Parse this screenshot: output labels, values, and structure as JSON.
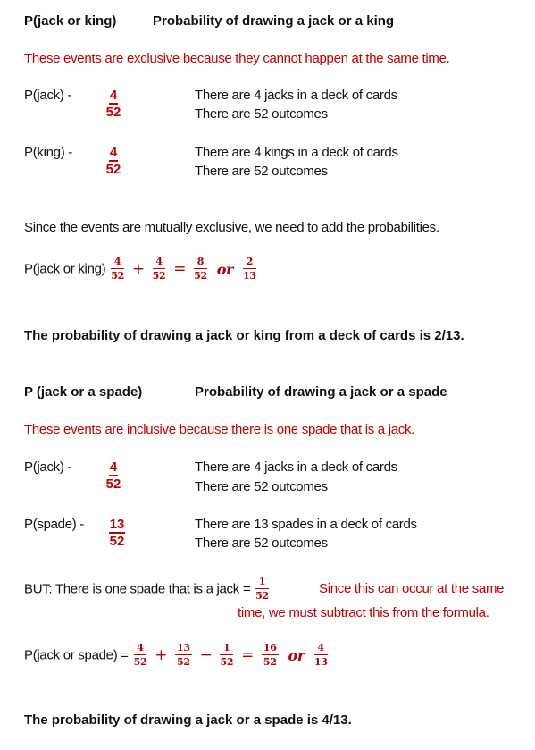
{
  "section1": {
    "label": "P(jack or king)",
    "title": "Probability of drawing a jack or a king",
    "note": "These events are exclusive because they cannot happen at the same time.",
    "rows": [
      {
        "label": "P(jack) -",
        "num": "4",
        "den": "52",
        "line1": "There are 4 jacks in a deck of cards",
        "line2": "There are 52 outcomes"
      },
      {
        "label": "P(king) -",
        "num": "4",
        "den": "52",
        "line1": "There are 4 kings in a deck of cards",
        "line2": "There are 52 outcomes"
      }
    ],
    "explanation": "Since the events are mutually exclusive, we need to add the probabilities.",
    "formula": {
      "label": "P(jack or king)",
      "terms": [
        {
          "num": "4",
          "den": "52"
        },
        {
          "op": "+"
        },
        {
          "num": "4",
          "den": "52"
        },
        {
          "op": "="
        },
        {
          "num": "8",
          "den": "52"
        },
        {
          "word": "or"
        },
        {
          "num": "2",
          "den": "13"
        }
      ]
    },
    "conclusion": "The probability of drawing a jack or king from a deck of cards is 2/13."
  },
  "section2": {
    "label": "P (jack or a spade)",
    "title": "Probability of drawing a jack or a spade",
    "note": "These events are inclusive because there is one spade that is a jack.",
    "rows": [
      {
        "label": "P(jack) -",
        "num": "4",
        "den": "52",
        "line1": "There are 4 jacks in a deck of cards",
        "line2": "There are 52 outcomes"
      },
      {
        "label": "P(spade) -",
        "num": "13",
        "den": "52",
        "line1": "There are 13 spades in a deck of cards",
        "line2": "There are 52 outcomes"
      }
    ],
    "but": {
      "text": "BUT:  There is one spade that is a jack =",
      "num": "1",
      "den": "52",
      "note_line1": "Since this can occur at the same",
      "note_line2": "time, we must subtract this from the formula."
    },
    "formula": {
      "label": "P(jack or spade) =",
      "terms": [
        {
          "num": "4",
          "den": "52"
        },
        {
          "op": "+"
        },
        {
          "num": "13",
          "den": "52"
        },
        {
          "op": "−"
        },
        {
          "num": "1",
          "den": "52"
        },
        {
          "op": "="
        },
        {
          "num": "16",
          "den": "52"
        },
        {
          "word": "or"
        },
        {
          "num": "4",
          "den": "13"
        }
      ]
    },
    "conclusion": "The probability of drawing a jack or a spade is 4/13."
  },
  "colors": {
    "accent_red": "#c00000",
    "divider": "#e2c9cc",
    "text": "#111111"
  }
}
